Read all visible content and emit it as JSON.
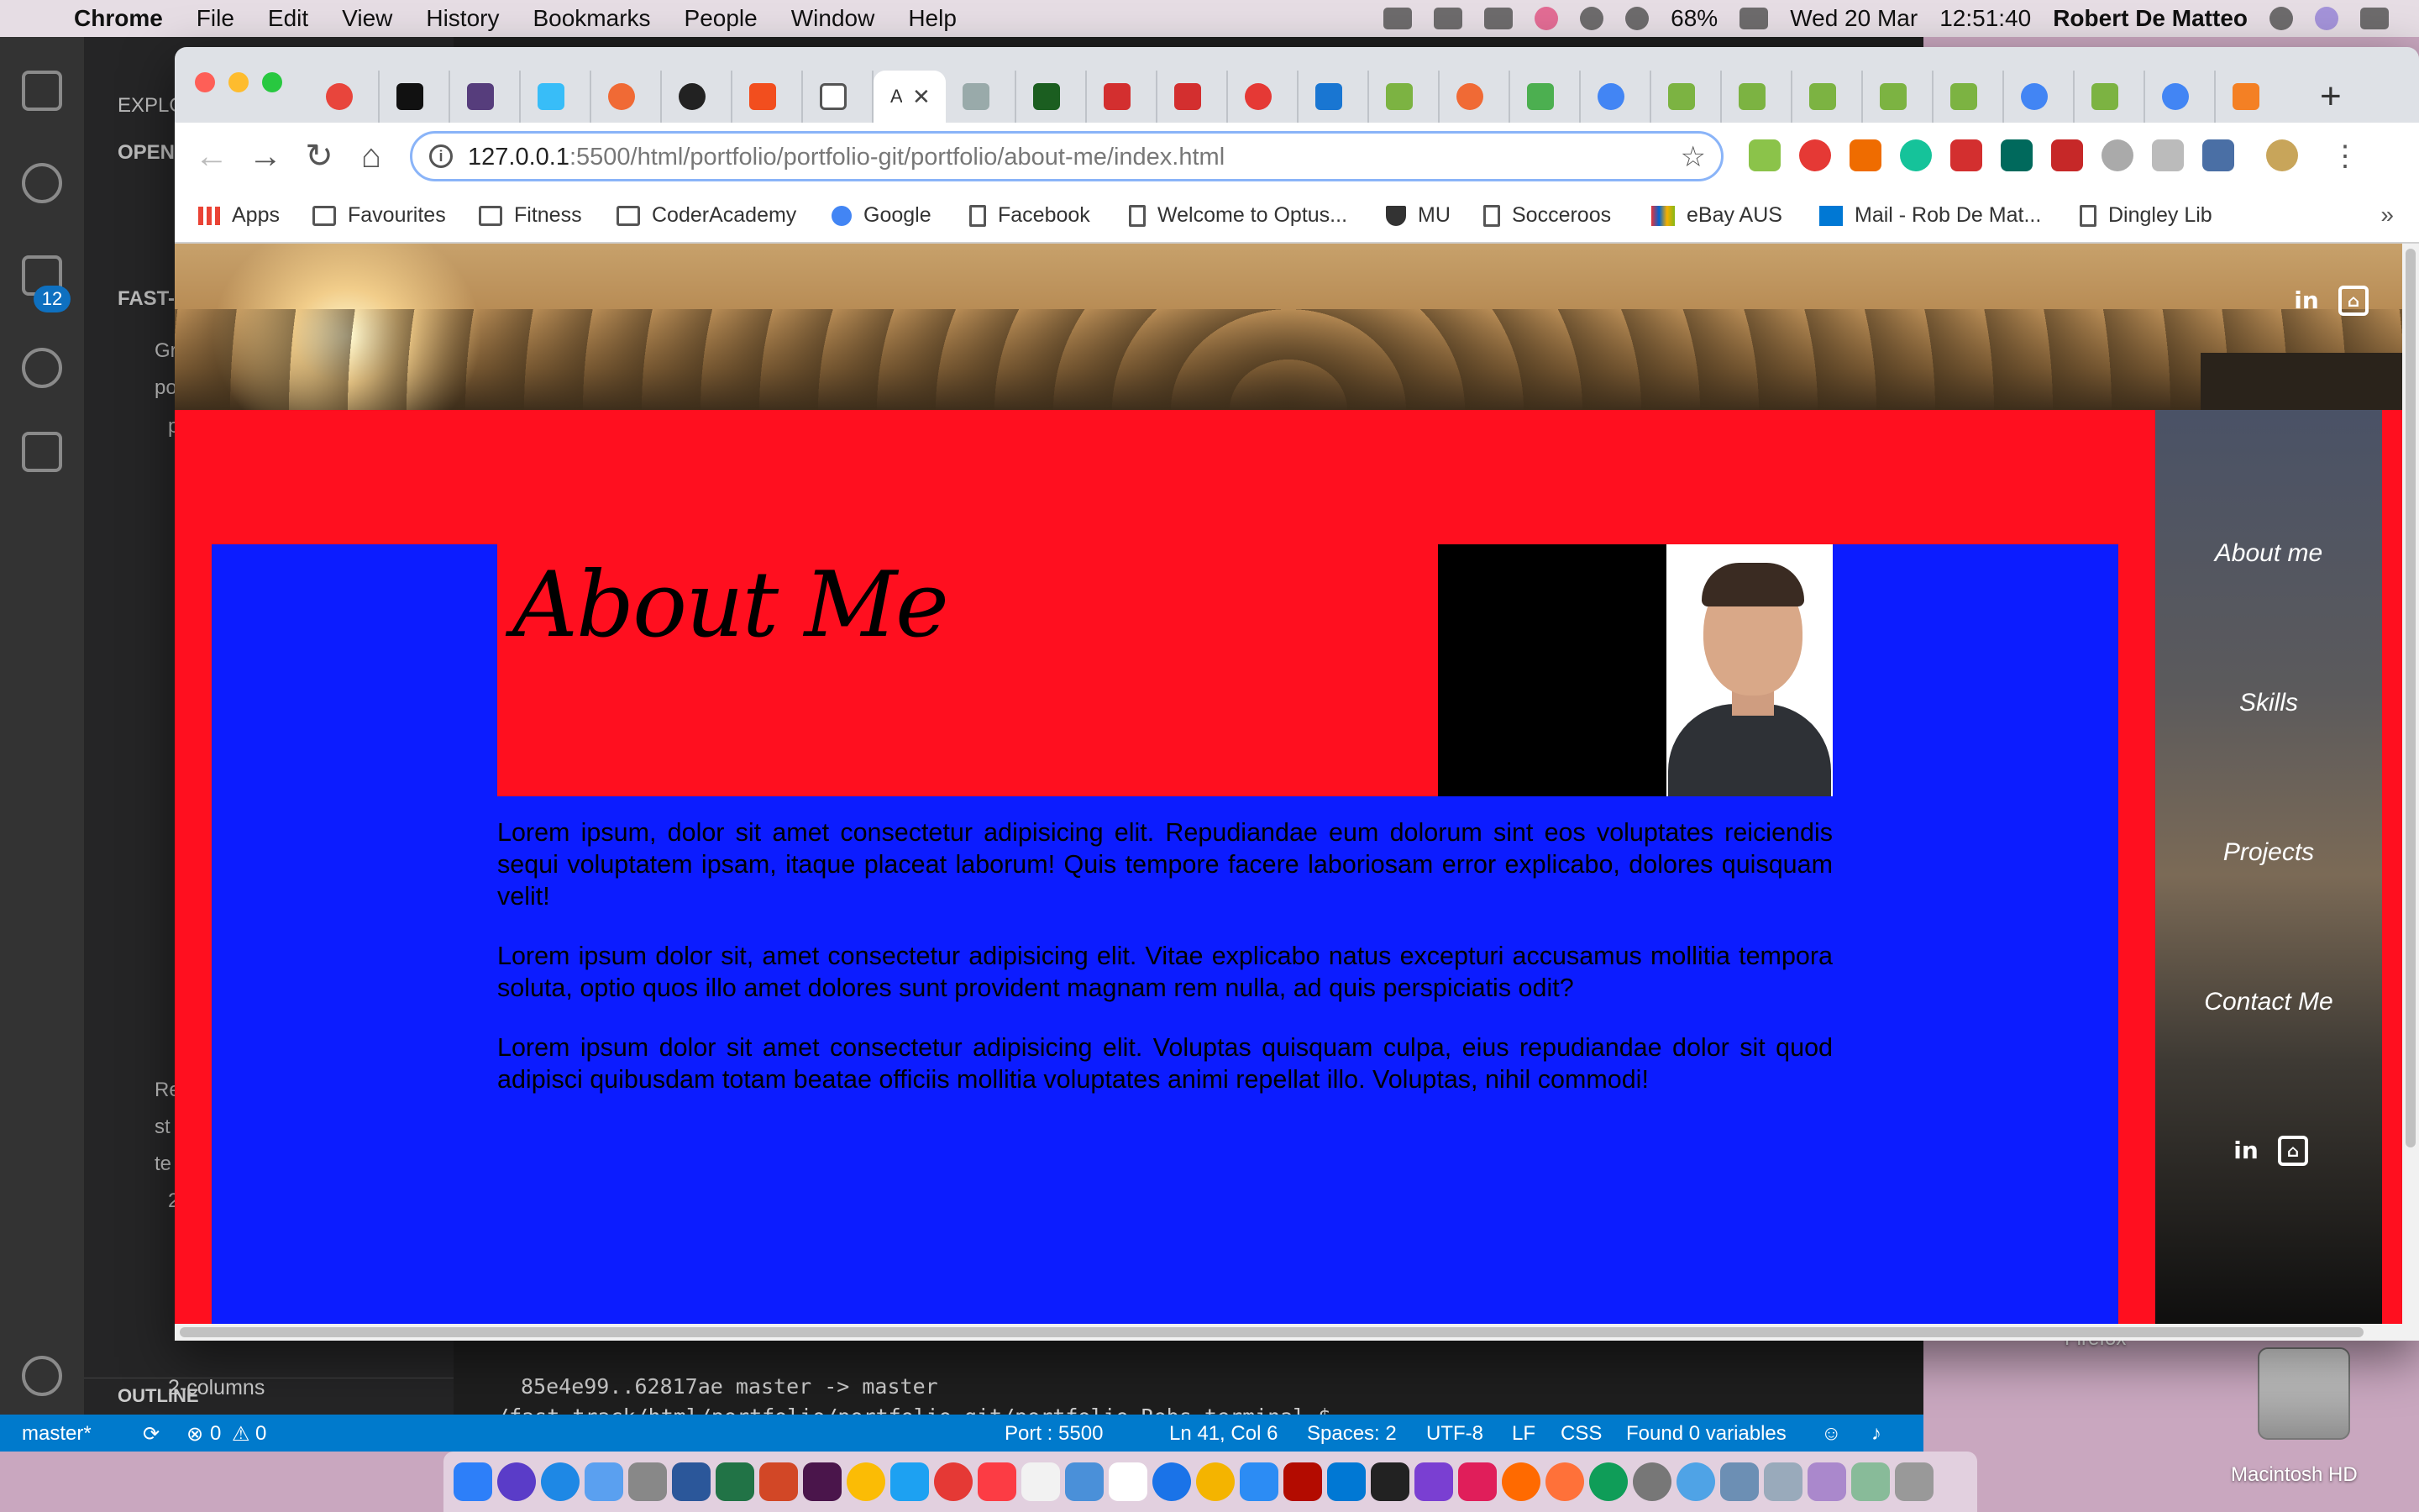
{
  "menubar": {
    "app": "Chrome",
    "items": [
      "File",
      "Edit",
      "View",
      "History",
      "Bookmarks",
      "People",
      "Window",
      "Help"
    ],
    "battery": "68%",
    "date": "Wed 20 Mar",
    "time": "12:51:40",
    "user": "Robert De Matteo"
  },
  "vscode": {
    "explorer_label": "EXPLO",
    "open_label": "OPEN",
    "fast_label": "FAST-",
    "scm_badge": "12",
    "tree": [
      "Gr",
      "po",
      "p",
      "Re",
      "st",
      "te",
      "2"
    ],
    "columns_item": "2-columns",
    "outline": "OUTLINE",
    "terminal": {
      "line1": "85e4e99..62817ae  master -> master",
      "line2": "~/fast-track/html/portfolio/portfolio-git/portfolio Robs terminal $"
    },
    "status": {
      "branch": "master*",
      "errors": "0",
      "warnings": "0",
      "port": "Port : 5500",
      "position": "Ln 41, Col 6",
      "spaces": "Spaces: 2",
      "encoding": "UTF-8",
      "eol": "LF",
      "language": "CSS",
      "variables": "Found 0 variables"
    }
  },
  "desktop": {
    "firefox_label": "Firefox",
    "hd_label": "Macintosh HD"
  },
  "chrome": {
    "active_tab_title": "A",
    "url_host": "127.0.0.1",
    "url_path": ":5500/html/portfolio/portfolio-git/portfolio/about-me/index.html",
    "bookmarks": [
      "Apps",
      "Favourites",
      "Fitness",
      "CoderAcademy",
      "Google",
      "Facebook",
      "Welcome to Optus...",
      "MU",
      "Socceroos",
      "eBay AUS",
      "Mail - Rob De Mat...",
      "Dingley Lib"
    ],
    "bookmarks_more": "»"
  },
  "page": {
    "title": "About Me",
    "paragraphs": [
      "Lorem ipsum, dolor sit amet consectetur adipisicing elit. Repudiandae eum dolorum sint eos voluptates reiciendis sequi voluptatem ipsam, itaque placeat laborum! Quis tempore facere laboriosam error explicabo, dolores quisquam velit!",
      "Lorem ipsum dolor sit, amet consectetur adipisicing elit. Vitae explicabo natus excepturi accusamus mollitia tempora soluta, optio quos illo amet dolores sunt provident magnam rem nulla, ad quis perspiciatis odit?",
      "Lorem ipsum dolor sit amet consectetur adipisicing elit. Voluptas quisquam culpa, eius repudiandae dolor sit quod adipisci quibusdam totam beatae officiis mollitia voluptates animi repellat illo. Voluptas, nihil commodi!"
    ],
    "nav": [
      "About me",
      "Skills",
      "Projects",
      "Contact Me"
    ],
    "social": {
      "linkedin": "in",
      "github": "⌂"
    },
    "colors": {
      "red": "#ff0f1f",
      "blue": "#0c1cff"
    }
  }
}
